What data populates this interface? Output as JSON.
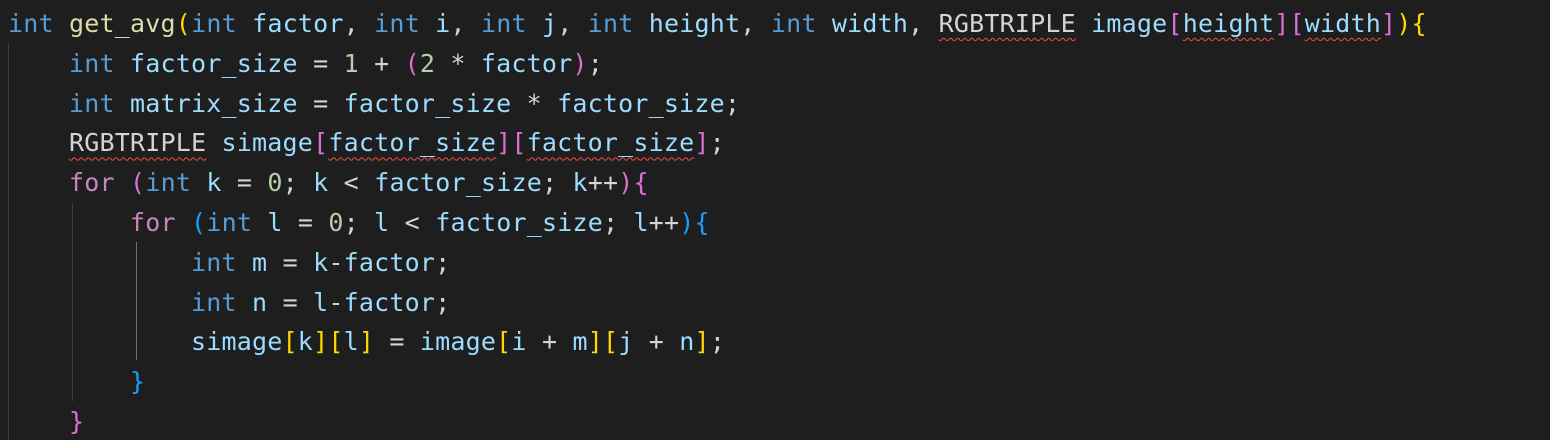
{
  "editor": {
    "language": "c",
    "theme": {
      "background": "#1e1e1e",
      "keyword": "#569cd6",
      "control": "#c586c0",
      "function": "#dcdcaa",
      "variable": "#9cdcfe",
      "type": "#4ec9b0",
      "number": "#b5cea8",
      "text": "#d4d4d4",
      "bracket1": "#ffd700",
      "bracket2": "#da70d6",
      "bracket3": "#179fff",
      "error": "#f14c4c"
    },
    "lines": [
      [
        {
          "t": "int",
          "c": "keyword"
        },
        {
          "t": " "
        },
        {
          "t": "get_avg",
          "c": "function"
        },
        {
          "t": "(",
          "c": "bracket1"
        },
        {
          "t": "int",
          "c": "keyword"
        },
        {
          "t": " "
        },
        {
          "t": "factor",
          "c": "variable"
        },
        {
          "t": ", "
        },
        {
          "t": "int",
          "c": "keyword"
        },
        {
          "t": " "
        },
        {
          "t": "i",
          "c": "variable"
        },
        {
          "t": ", "
        },
        {
          "t": "int",
          "c": "keyword"
        },
        {
          "t": " "
        },
        {
          "t": "j",
          "c": "variable"
        },
        {
          "t": ", "
        },
        {
          "t": "int",
          "c": "keyword"
        },
        {
          "t": " "
        },
        {
          "t": "height",
          "c": "variable"
        },
        {
          "t": ", "
        },
        {
          "t": "int",
          "c": "keyword"
        },
        {
          "t": " "
        },
        {
          "t": "width",
          "c": "variable"
        },
        {
          "t": ", "
        },
        {
          "t": "RGBTRIPLE",
          "c": "text",
          "err": true
        },
        {
          "t": " "
        },
        {
          "t": "image",
          "c": "variable"
        },
        {
          "t": "[",
          "c": "bracket2"
        },
        {
          "t": "height",
          "c": "variable",
          "err": true
        },
        {
          "t": "]",
          "c": "bracket2"
        },
        {
          "t": "[",
          "c": "bracket2"
        },
        {
          "t": "width",
          "c": "variable",
          "err": true
        },
        {
          "t": "]",
          "c": "bracket2"
        },
        {
          "t": ")",
          "c": "bracket1"
        },
        {
          "t": "{",
          "c": "bracket1"
        }
      ],
      [
        {
          "t": "    "
        },
        {
          "t": "int",
          "c": "keyword"
        },
        {
          "t": " "
        },
        {
          "t": "factor_size",
          "c": "variable"
        },
        {
          "t": " = "
        },
        {
          "t": "1",
          "c": "number"
        },
        {
          "t": " + "
        },
        {
          "t": "(",
          "c": "bracket2"
        },
        {
          "t": "2",
          "c": "number"
        },
        {
          "t": " * "
        },
        {
          "t": "factor",
          "c": "variable"
        },
        {
          "t": ")",
          "c": "bracket2"
        },
        {
          "t": ";"
        }
      ],
      [
        {
          "t": "    "
        },
        {
          "t": "int",
          "c": "keyword"
        },
        {
          "t": " "
        },
        {
          "t": "matrix_size",
          "c": "variable"
        },
        {
          "t": " = "
        },
        {
          "t": "factor_size",
          "c": "variable"
        },
        {
          "t": " * "
        },
        {
          "t": "factor_size",
          "c": "variable"
        },
        {
          "t": ";"
        }
      ],
      [
        {
          "t": "    "
        },
        {
          "t": "RGBTRIPLE",
          "c": "text",
          "err": true
        },
        {
          "t": " "
        },
        {
          "t": "simage",
          "c": "variable"
        },
        {
          "t": "[",
          "c": "bracket2"
        },
        {
          "t": "factor_size",
          "c": "variable",
          "err": true
        },
        {
          "t": "]",
          "c": "bracket2"
        },
        {
          "t": "[",
          "c": "bracket2"
        },
        {
          "t": "factor_size",
          "c": "variable",
          "err": true
        },
        {
          "t": "]",
          "c": "bracket2"
        },
        {
          "t": ";"
        }
      ],
      [
        {
          "t": "    "
        },
        {
          "t": "for",
          "c": "control"
        },
        {
          "t": " "
        },
        {
          "t": "(",
          "c": "bracket2"
        },
        {
          "t": "int",
          "c": "keyword"
        },
        {
          "t": " "
        },
        {
          "t": "k",
          "c": "variable"
        },
        {
          "t": " = "
        },
        {
          "t": "0",
          "c": "number"
        },
        {
          "t": "; "
        },
        {
          "t": "k",
          "c": "variable"
        },
        {
          "t": " < "
        },
        {
          "t": "factor_size",
          "c": "variable"
        },
        {
          "t": "; "
        },
        {
          "t": "k",
          "c": "variable"
        },
        {
          "t": "++"
        },
        {
          "t": ")",
          "c": "bracket2"
        },
        {
          "t": "{",
          "c": "bracket2"
        }
      ],
      [
        {
          "t": "        "
        },
        {
          "t": "for",
          "c": "control"
        },
        {
          "t": " "
        },
        {
          "t": "(",
          "c": "bracket3"
        },
        {
          "t": "int",
          "c": "keyword"
        },
        {
          "t": " "
        },
        {
          "t": "l",
          "c": "variable"
        },
        {
          "t": " = "
        },
        {
          "t": "0",
          "c": "number"
        },
        {
          "t": "; "
        },
        {
          "t": "l",
          "c": "variable"
        },
        {
          "t": " < "
        },
        {
          "t": "factor_size",
          "c": "variable"
        },
        {
          "t": "; "
        },
        {
          "t": "l",
          "c": "variable"
        },
        {
          "t": "++"
        },
        {
          "t": ")",
          "c": "bracket3"
        },
        {
          "t": "{",
          "c": "bracket3"
        }
      ],
      [
        {
          "t": "            "
        },
        {
          "t": "int",
          "c": "keyword"
        },
        {
          "t": " "
        },
        {
          "t": "m",
          "c": "variable"
        },
        {
          "t": " = "
        },
        {
          "t": "k",
          "c": "variable"
        },
        {
          "t": "-"
        },
        {
          "t": "factor",
          "c": "variable"
        },
        {
          "t": ";"
        }
      ],
      [
        {
          "t": "            "
        },
        {
          "t": "int",
          "c": "keyword"
        },
        {
          "t": " "
        },
        {
          "t": "n",
          "c": "variable"
        },
        {
          "t": " = "
        },
        {
          "t": "l",
          "c": "variable"
        },
        {
          "t": "-"
        },
        {
          "t": "factor",
          "c": "variable"
        },
        {
          "t": ";"
        }
      ],
      [
        {
          "t": "            "
        },
        {
          "t": "simage",
          "c": "variable"
        },
        {
          "t": "[",
          "c": "bracket1"
        },
        {
          "t": "k",
          "c": "variable"
        },
        {
          "t": "]",
          "c": "bracket1"
        },
        {
          "t": "[",
          "c": "bracket1"
        },
        {
          "t": "l",
          "c": "variable"
        },
        {
          "t": "]",
          "c": "bracket1"
        },
        {
          "t": " = "
        },
        {
          "t": "image",
          "c": "variable"
        },
        {
          "t": "[",
          "c": "bracket1"
        },
        {
          "t": "i",
          "c": "variable"
        },
        {
          "t": " + "
        },
        {
          "t": "m",
          "c": "variable"
        },
        {
          "t": "]",
          "c": "bracket1"
        },
        {
          "t": "[",
          "c": "bracket1"
        },
        {
          "t": "j",
          "c": "variable"
        },
        {
          "t": " + "
        },
        {
          "t": "n",
          "c": "variable"
        },
        {
          "t": "]",
          "c": "bracket1"
        },
        {
          "t": ";"
        }
      ],
      [
        {
          "t": "        "
        },
        {
          "t": "}",
          "c": "bracket3"
        }
      ],
      [
        {
          "t": "    "
        },
        {
          "t": "}",
          "c": "bracket2"
        }
      ]
    ]
  }
}
